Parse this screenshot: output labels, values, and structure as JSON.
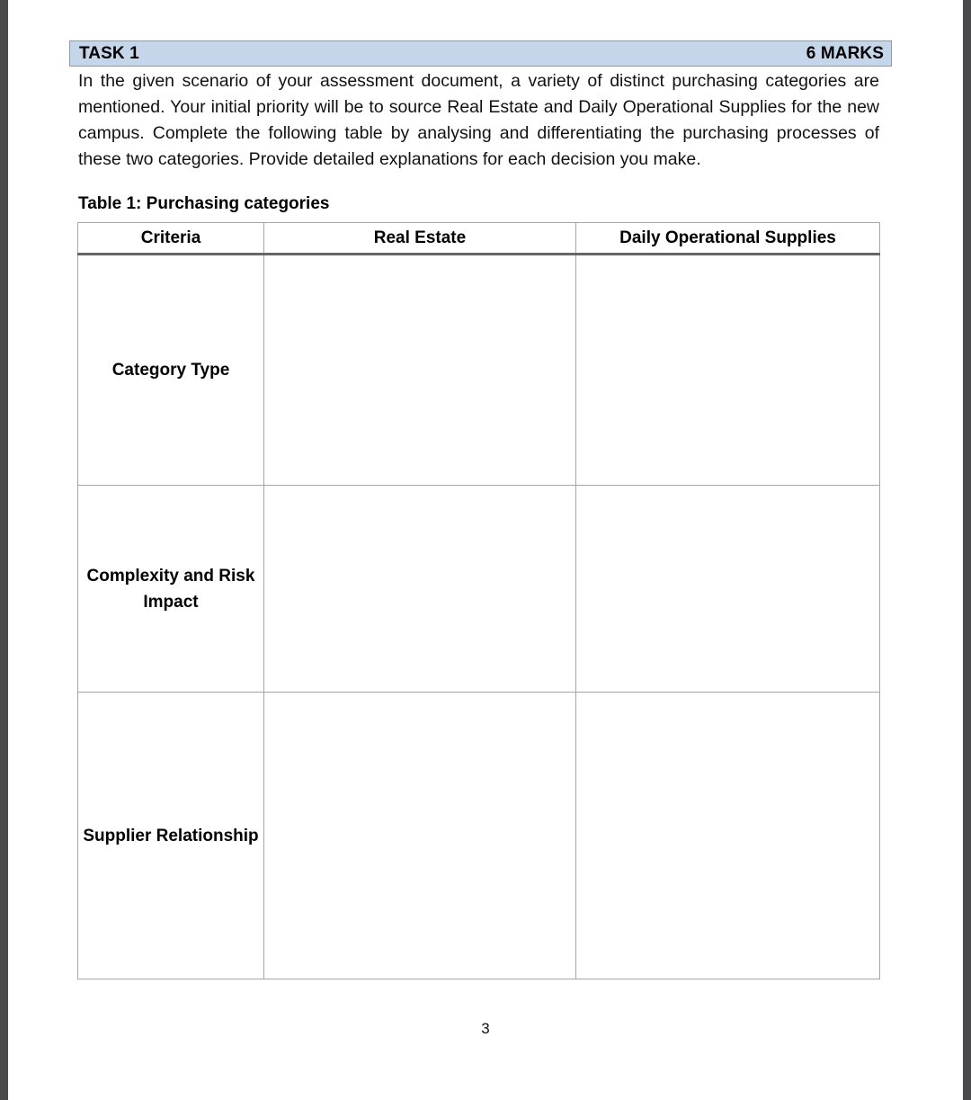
{
  "document": {
    "page_number": "3"
  },
  "task": {
    "label": "TASK 1",
    "marks": "6 MARKS",
    "banner_color": "#c5d5ea"
  },
  "intro": {
    "paragraph": "In the given scenario of your assessment document, a variety of distinct purchasing categories are mentioned. Your initial priority will be to source Real Estate and Daily Operational Supplies for the new campus. Complete the following table by analysing and differentiating the purchasing processes of these two categories. Provide detailed explanations for each decision you make."
  },
  "table": {
    "caption": "Table 1: Purchasing categories",
    "headers": [
      "Criteria",
      "Real Estate",
      "Daily Operational Supplies"
    ],
    "rows": [
      {
        "criteria": "Category Type",
        "real_estate": "",
        "daily_operational_supplies": ""
      },
      {
        "criteria": "Complexity and Risk Impact",
        "real_estate": "",
        "daily_operational_supplies": ""
      },
      {
        "criteria": "Supplier Relationship",
        "real_estate": "",
        "daily_operational_supplies": ""
      }
    ]
  }
}
